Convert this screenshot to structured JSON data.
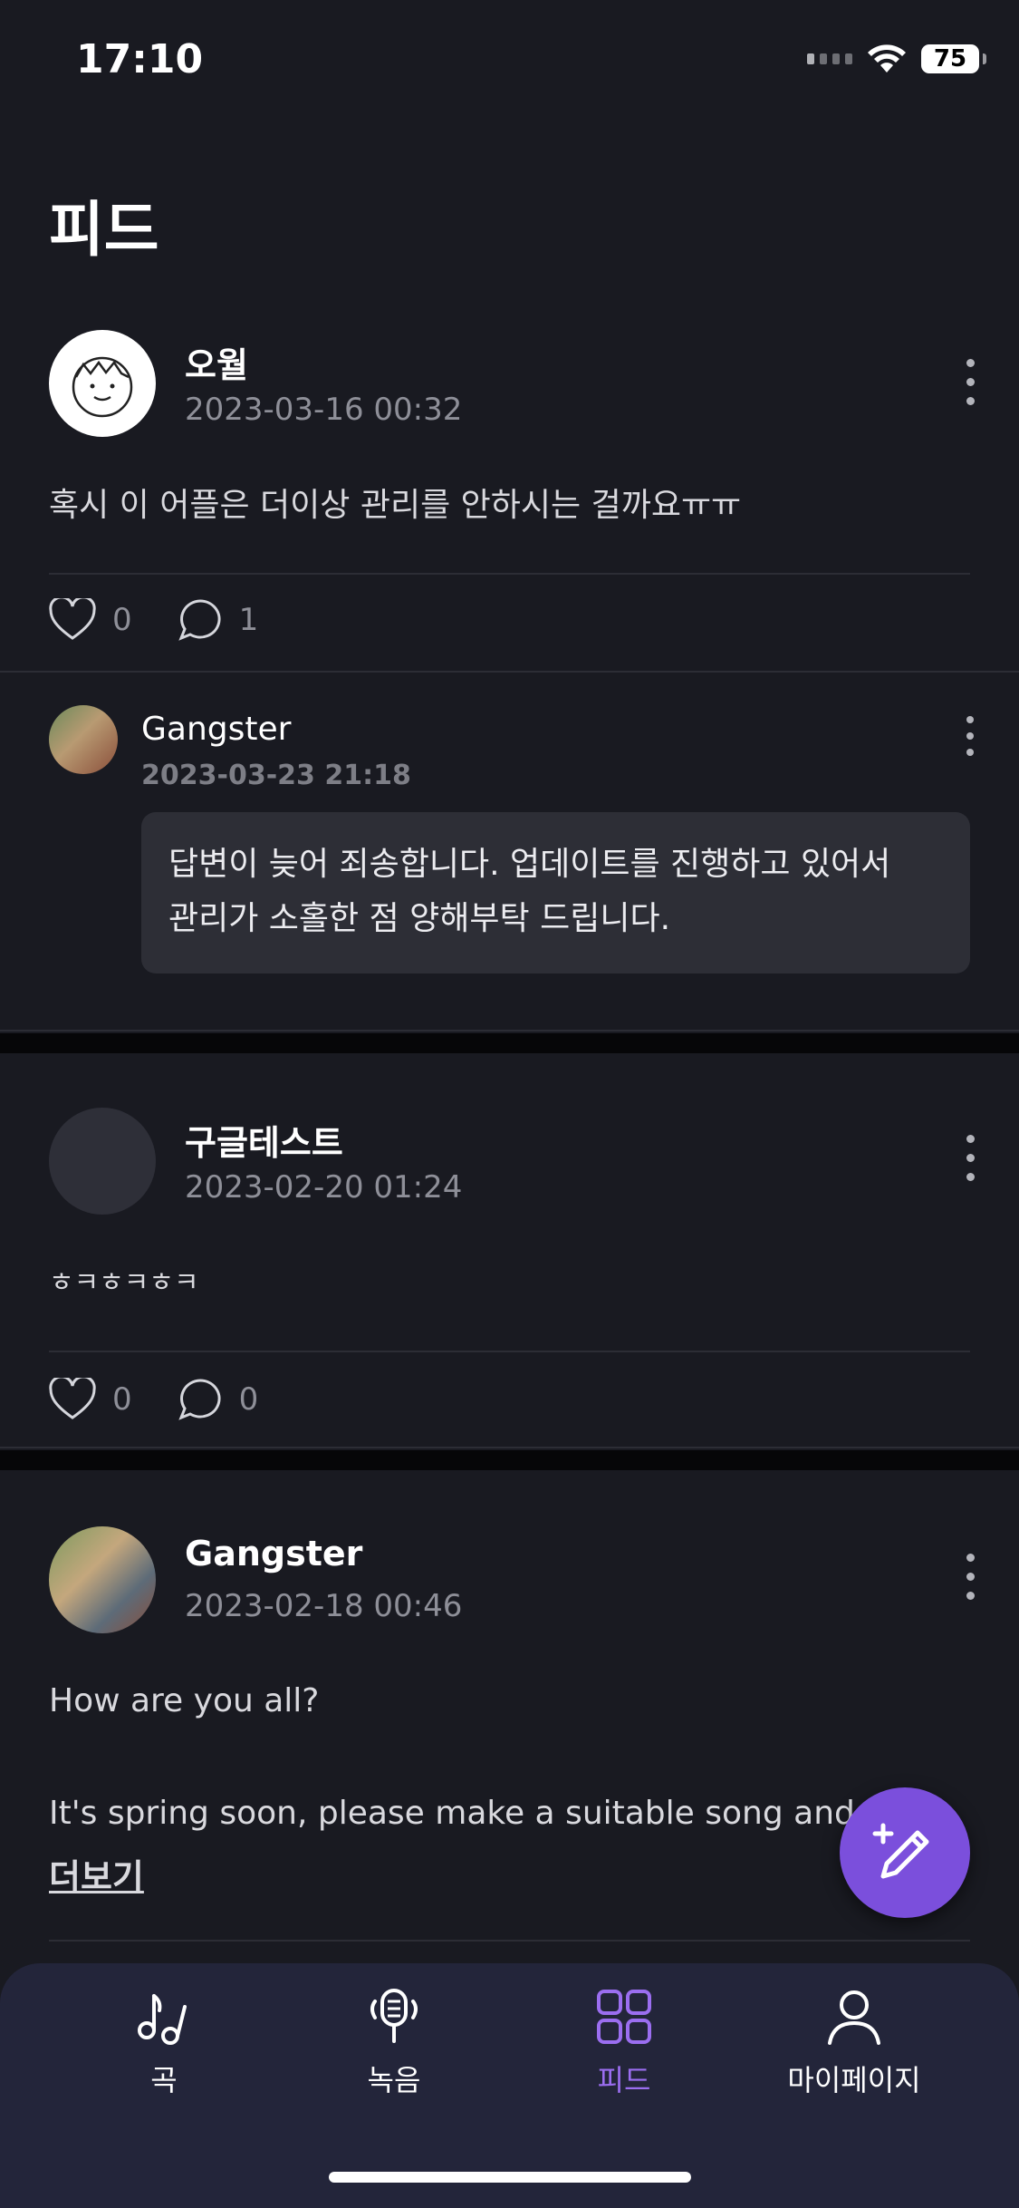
{
  "status_bar": {
    "time": "17:10",
    "battery": "75"
  },
  "page": {
    "title": "피드"
  },
  "posts": [
    {
      "author": "오월",
      "date": "2023-03-16 00:32",
      "body": "혹시 이 어플은 더이상 관리를 안하시는 걸까요ㅠㅠ",
      "likes": "0",
      "comments": "1",
      "reply": {
        "author": "Gangster",
        "date": "2023-03-23 21:18",
        "text": "답변이 늦어 죄송합니다. 업데이트를 진행하고 있어서\n관리가 소홀한 점 양해부탁 드립니다."
      }
    },
    {
      "author": "구글테스트",
      "date": "2023-02-20 01:24",
      "body": "ㅎㅋㅎㅋㅎㅋ",
      "likes": "0",
      "comments": "0"
    },
    {
      "author": "Gangster",
      "date": "2023-02-18 00:46",
      "body": "How are you all?\n\nIt's spring soon, please make a suitable song and",
      "more_label": "더보기"
    }
  ],
  "tabs": [
    {
      "label": "곡",
      "icon": "music-note-icon"
    },
    {
      "label": "녹음",
      "icon": "microphone-icon"
    },
    {
      "label": "피드",
      "icon": "grid-icon",
      "active": true
    },
    {
      "label": "마이페이지",
      "icon": "person-icon"
    }
  ],
  "colors": {
    "accent": "#7b4fdc",
    "background": "#191a21",
    "tab_bar": "#23253a"
  }
}
